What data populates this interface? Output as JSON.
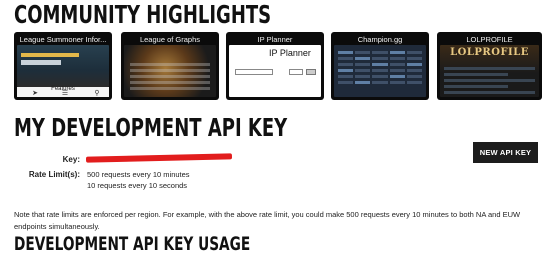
{
  "community": {
    "heading": "COMMUNITY HIGHLIGHTS",
    "tiles": [
      {
        "title": "League Summoner Infor...",
        "features_label": "Features"
      },
      {
        "title": "League of Graphs"
      },
      {
        "title": "IP Planner",
        "inner_title": "IP Planner"
      },
      {
        "title": "Champion.gg"
      },
      {
        "title": "LOLPROFILE",
        "logo_text": "LOLPROFILE"
      }
    ]
  },
  "api_key": {
    "heading": "MY DEVELOPMENT API KEY",
    "key_label": "Key:",
    "rate_label": "Rate Limit(s):",
    "rate_limits": [
      "500 requests every 10 minutes",
      "10 requests every 10 seconds"
    ],
    "new_key_button": "NEW API KEY",
    "note": "Note that rate limits are enforced per region. For example, with the above rate limit, you could make 500 requests every 10 minutes to both NA and EUW endpoints simultaneously."
  },
  "usage": {
    "heading": "DEVELOPMENT API KEY USAGE"
  },
  "colors": {
    "redaction": "#e21d1d",
    "button_bg": "#1d1d1d"
  }
}
